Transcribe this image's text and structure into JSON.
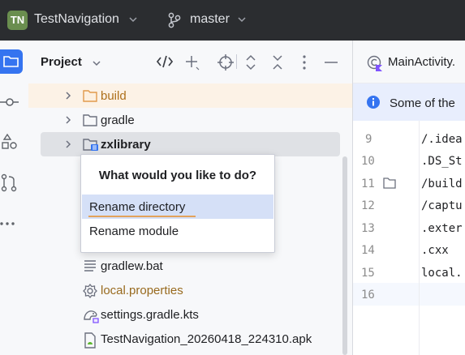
{
  "titlebar": {
    "project_badge": "TN",
    "project_name": "TestNavigation",
    "branch_name": "master",
    "badge_color": "#6a8e4f"
  },
  "panel": {
    "title": "Project"
  },
  "tree": [
    {
      "label": "build",
      "icon": "folder-icon",
      "expandable": true,
      "color": "orange"
    },
    {
      "label": "gradle",
      "icon": "folder-icon",
      "expandable": true
    },
    {
      "label": "zxlibrary",
      "icon": "module-folder-icon",
      "expandable": true,
      "selected": true
    },
    {
      "label": "gradlew.bat",
      "icon": "text-file-icon"
    },
    {
      "label": "local.properties",
      "icon": "gear-icon",
      "color": "brown"
    },
    {
      "label": "settings.gradle.kts",
      "icon": "gradle-file-icon"
    },
    {
      "label": "TestNavigation_20260418_224310.apk",
      "icon": "android-file-icon"
    }
  ],
  "popup": {
    "title": "What would you like to do?",
    "options": [
      "Rename directory",
      "Rename module"
    ],
    "selected_index": 0
  },
  "editor": {
    "tab_label": "MainActivity.",
    "banner_text": "Some of the",
    "lines": [
      {
        "num": "9",
        "text": "/.idea"
      },
      {
        "num": "10",
        "text": ".DS_St"
      },
      {
        "num": "11",
        "text": "/build"
      },
      {
        "num": "12",
        "text": "/captu"
      },
      {
        "num": "13",
        "text": ".exter"
      },
      {
        "num": "14",
        "text": ".cxx"
      },
      {
        "num": "15",
        "text": "local."
      },
      {
        "num": "16",
        "text": ""
      }
    ]
  },
  "colors": {
    "accent": "#3574f0",
    "popup_selection": "#d5e0f7",
    "excluded_highlight": "#fcf2e6"
  }
}
